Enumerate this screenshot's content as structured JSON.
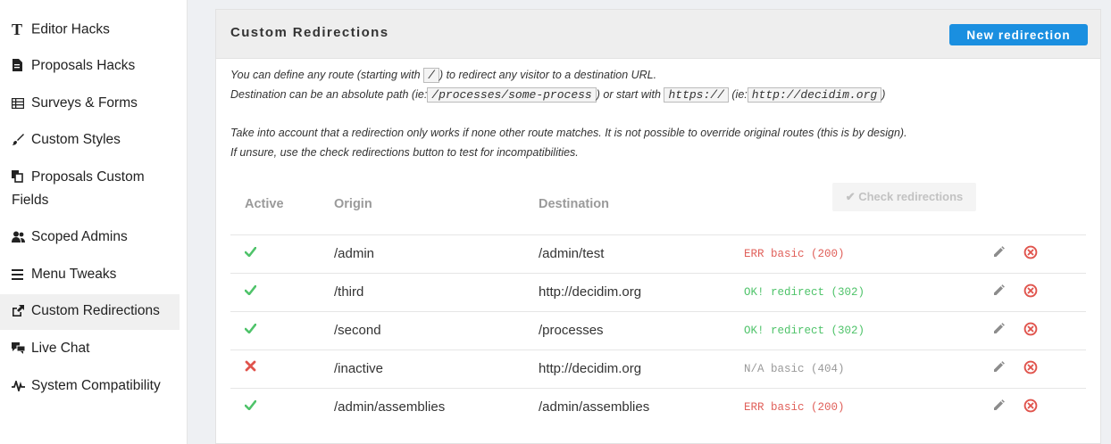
{
  "sidebar": {
    "items": [
      {
        "label": "Editor Hacks",
        "icon": "text-t-icon"
      },
      {
        "label": "Proposals Hacks",
        "icon": "document-icon"
      },
      {
        "label": "Surveys & Forms",
        "icon": "list-table-icon"
      },
      {
        "label": "Custom Styles",
        "icon": "paintbrush-icon"
      },
      {
        "label": "Proposals Custom",
        "label2": "Fields",
        "icon": "copy-icon"
      },
      {
        "label": "Scoped Admins",
        "icon": "users-icon"
      },
      {
        "label": "Menu Tweaks",
        "icon": "menu-icon"
      },
      {
        "label": "Custom Redirections",
        "icon": "external-link-icon",
        "active": true
      },
      {
        "label": "Live Chat",
        "icon": "chat-icon"
      },
      {
        "label": "System Compatibility",
        "icon": "pulse-icon"
      }
    ]
  },
  "card": {
    "title": "Custom Redirections",
    "new_button": "New redirection",
    "intro": {
      "line1_a": "You can define any route (starting with",
      "line1_code": "/",
      "line1_b": ") to redirect any visitor to a destination URL.",
      "line2_a": "Destination can be an absolute path (ie:",
      "line2_code1": "/processes/some-process",
      "line2_b": ") or start with",
      "line2_code2": "https://",
      "line2_c": "(ie:",
      "line2_code3": "http://decidim.org",
      "line2_d": ")",
      "line3": "Take into account that a redirection only works if none other route matches. It is not possible to override original routes (this is by design).",
      "line4": "If unsure, use the check redirections button to test for incompatibilities."
    },
    "check_button": "✔ Check redirections",
    "table": {
      "headers": {
        "active": "Active",
        "origin": "Origin",
        "destination": "Destination"
      },
      "rows": [
        {
          "active": true,
          "origin": "/admin",
          "destination": "/admin/test",
          "status": "ERR basic (200)",
          "status_type": "err"
        },
        {
          "active": true,
          "origin": "/third",
          "destination": "http://decidim.org",
          "status": "OK! redirect (302)",
          "status_type": "ok"
        },
        {
          "active": true,
          "origin": "/second",
          "destination": "/processes",
          "status": "OK! redirect (302)",
          "status_type": "ok"
        },
        {
          "active": false,
          "origin": "/inactive",
          "destination": "http://decidim.org",
          "status": "N/A basic (404)",
          "status_type": "na"
        },
        {
          "active": true,
          "origin": "/admin/assemblies",
          "destination": "/admin/assemblies",
          "status": "ERR basic (200)",
          "status_type": "err"
        }
      ]
    }
  },
  "colors": {
    "accent": "#1a8fe0",
    "ok": "#4fc36a",
    "err": "#e0605a",
    "delete": "#e0534c"
  }
}
